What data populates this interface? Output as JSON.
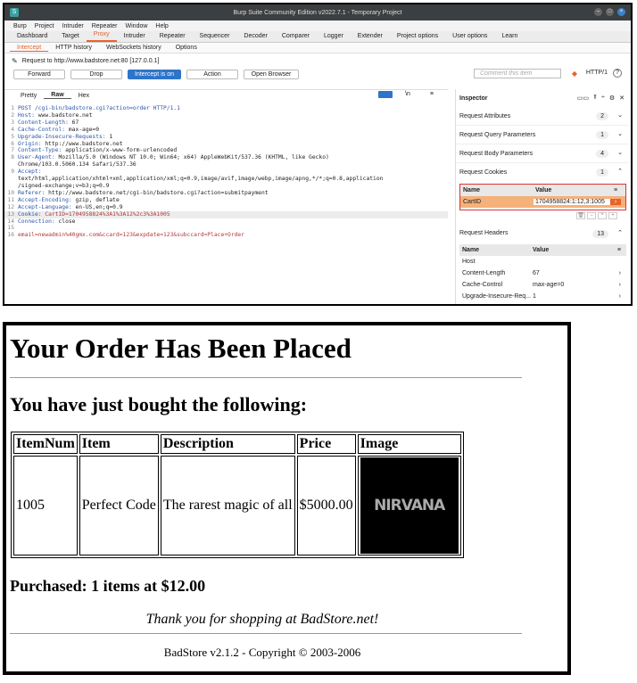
{
  "burp": {
    "window_title": "Burp Suite Community Edition v2022.7.1 - Temporary Project",
    "menu": [
      "Burp",
      "Project",
      "Intruder",
      "Repeater",
      "Window",
      "Help"
    ],
    "main_tabs": [
      "Dashboard",
      "Target",
      "Proxy",
      "Intruder",
      "Repeater",
      "Sequencer",
      "Decoder",
      "Comparer",
      "Logger",
      "Extender",
      "Project options",
      "User options",
      "Learn"
    ],
    "sub_tabs": [
      "Intercept",
      "HTTP history",
      "WebSockets history",
      "Options"
    ],
    "request_to": "Request to http://www.badstore.net:80  [127.0.0.1]",
    "buttons": {
      "forward": "Forward",
      "drop": "Drop",
      "intercept": "Intercept is on",
      "action": "Action",
      "open_browser": "Open Browser"
    },
    "comment_placeholder": "Comment this item",
    "http_version": "HTTP/1",
    "editor_tabs": [
      "Pretty",
      "Raw",
      "Hex"
    ],
    "request_lines": [
      {
        "n": "1",
        "k": "POST /cgi-bin/badstore.cgi?action=order HTTP/1.1",
        "v": ""
      },
      {
        "n": "2",
        "k": "Host: ",
        "v": "www.badstore.net"
      },
      {
        "n": "3",
        "k": "Content-Length: ",
        "v": "67"
      },
      {
        "n": "4",
        "k": "Cache-Control: ",
        "v": "max-age=0"
      },
      {
        "n": "5",
        "k": "Upgrade-Insecure-Requests: ",
        "v": "1"
      },
      {
        "n": "6",
        "k": "Origin: ",
        "v": "http://www.badstore.net"
      },
      {
        "n": "7",
        "k": "Content-Type: ",
        "v": "application/x-www-form-urlencoded"
      },
      {
        "n": "8",
        "k": "User-Agent: ",
        "v": "Mozilla/5.0 (Windows NT 10.0; Win64; x64) AppleWebKit/537.36 (KHTML, like Gecko)"
      },
      {
        "n": "",
        "k": "",
        "v": "Chrome/103.0.5060.134 Safari/537.36"
      },
      {
        "n": "9",
        "k": "Accept:",
        "v": ""
      },
      {
        "n": "",
        "k": "",
        "v": "text/html,application/xhtml+xml,application/xml;q=0.9,image/avif,image/webp,image/apng,*/*;q=0.8,application"
      },
      {
        "n": "",
        "k": "",
        "v": "/signed-exchange;v=b3;q=0.9"
      },
      {
        "n": "10",
        "k": "Referer: ",
        "v": "http://www.badstore.net/cgi-bin/badstore.cgi?action=submitpayment"
      },
      {
        "n": "11",
        "k": "Accept-Encoding: ",
        "v": "gzip, deflate"
      },
      {
        "n": "12",
        "k": "Accept-Language: ",
        "v": "en-US,en;q=0.9"
      },
      {
        "n": "13",
        "k": "Cookie: ",
        "v": "",
        "r": "CartID=1704958824%3A1%3A12%2c3%3A1005"
      },
      {
        "n": "14",
        "k": "Connection: ",
        "v": "close"
      },
      {
        "n": "15",
        "k": "",
        "v": ""
      },
      {
        "n": "16",
        "k": "",
        "v": "",
        "r": "email=newadmin%40gmx.com&ccard=123&expdate=123&subccard=Place+Order"
      }
    ],
    "inspector": {
      "title": "Inspector",
      "sections": [
        {
          "label": "Request Attributes",
          "count": "2"
        },
        {
          "label": "Request Query Parameters",
          "count": "1"
        },
        {
          "label": "Request Body Parameters",
          "count": "4"
        },
        {
          "label": "Request Cookies",
          "count": "1"
        }
      ],
      "cookie_table": {
        "col_name": "Name",
        "col_value": "Value",
        "name": "CartID",
        "value": "1704958824:1:12,3:1005"
      },
      "headers_section": {
        "label": "Request Headers",
        "count": "13"
      },
      "headers_table": {
        "col_name": "Name",
        "col_value": "Value",
        "rows": [
          {
            "name": "Host",
            "value": ""
          },
          {
            "name": "Content-Length",
            "value": "67"
          },
          {
            "name": "Cache-Control",
            "value": "max-age=0"
          },
          {
            "name": "Upgrade-Insecure-Req...",
            "value": "1"
          }
        ]
      }
    }
  },
  "order": {
    "heading": "Your Order Has Been Placed",
    "subheading": "You have just bought the following:",
    "columns": [
      "ItemNum",
      "Item",
      "Description",
      "Price",
      "Image"
    ],
    "row": {
      "itemnum": "1005",
      "item": "Perfect Code",
      "description": "The rarest magic of all",
      "price": "$5000.00",
      "image_text": "NIRVANA"
    },
    "purchased": "Purchased: 1 items at $12.00",
    "thanks": "Thank you for shopping at BadStore.net!",
    "footer": "BadStore v2.1.2 - Copyright © 2003-2006"
  }
}
